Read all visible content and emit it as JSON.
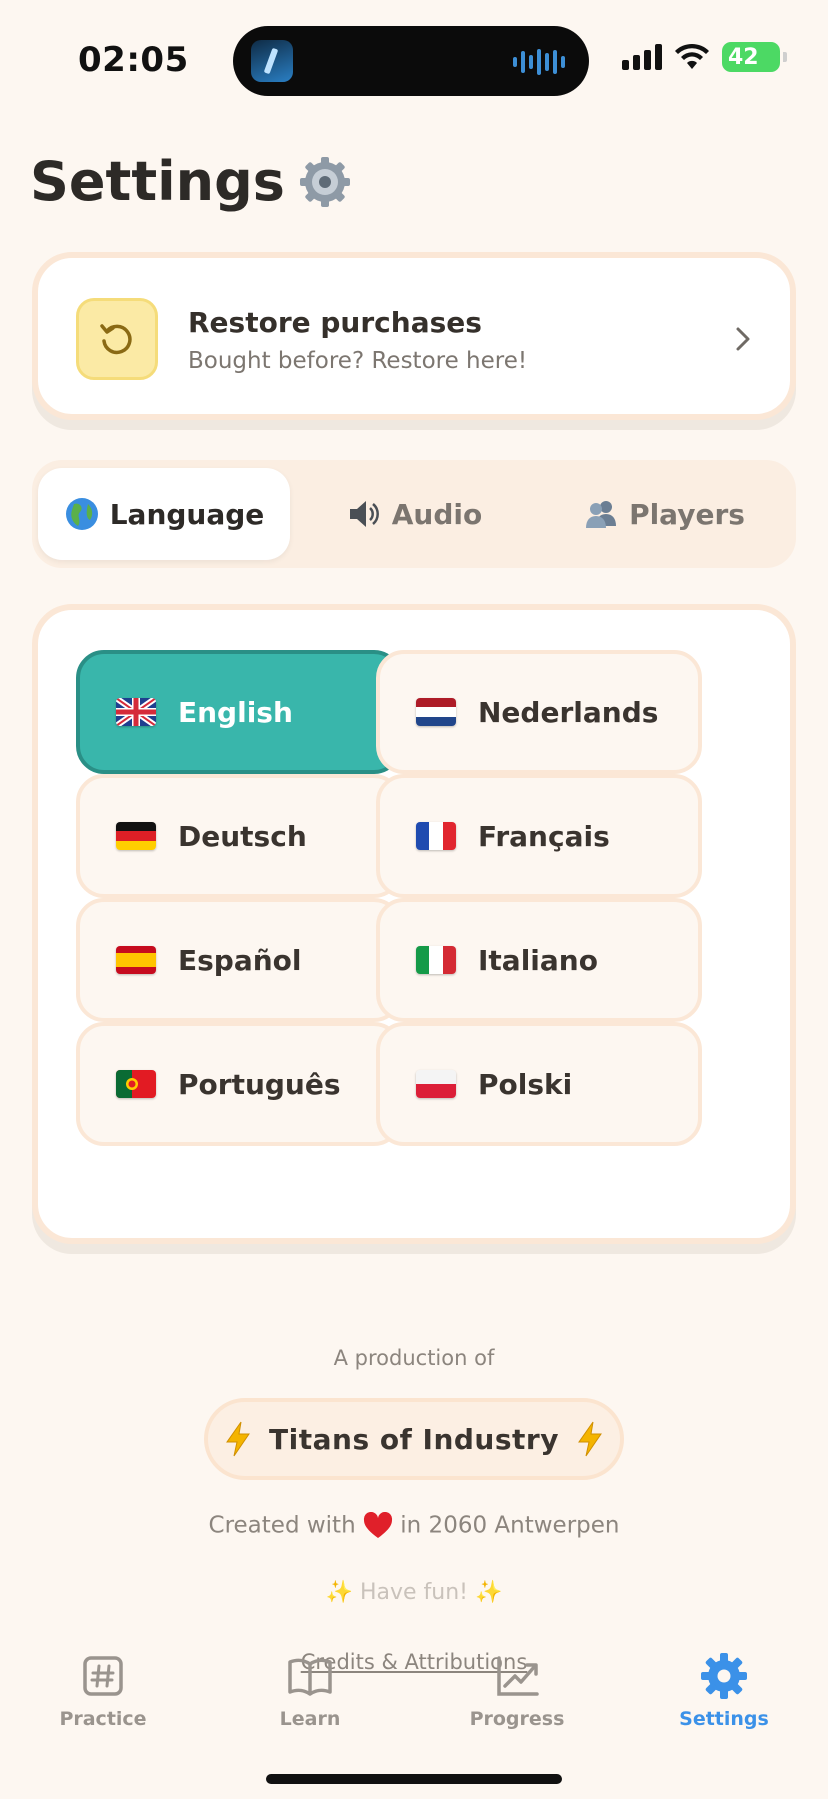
{
  "status_bar": {
    "time": "02:05",
    "battery_percent": "42"
  },
  "header": {
    "title": "Settings",
    "title_icon": "gear-icon"
  },
  "restore": {
    "title": "Restore purchases",
    "subtitle": "Bought before? Restore here!",
    "icon": "restore-icon"
  },
  "tabs": [
    {
      "label": "Language",
      "icon": "globe-icon",
      "active": true
    },
    {
      "label": "Audio",
      "icon": "speaker-icon",
      "active": false
    },
    {
      "label": "Players",
      "icon": "players-icon",
      "active": false
    }
  ],
  "languages": [
    {
      "label": "English",
      "flag": "uk-flag",
      "selected": true
    },
    {
      "label": "Nederlands",
      "flag": "nl-flag",
      "selected": false
    },
    {
      "label": "Deutsch",
      "flag": "de-flag",
      "selected": false
    },
    {
      "label": "Français",
      "flag": "fr-flag",
      "selected": false
    },
    {
      "label": "Español",
      "flag": "es-flag",
      "selected": false
    },
    {
      "label": "Italiano",
      "flag": "it-flag",
      "selected": false
    },
    {
      "label": "Português",
      "flag": "pt-flag",
      "selected": false
    },
    {
      "label": "Polski",
      "flag": "pl-flag",
      "selected": false
    }
  ],
  "footer": {
    "production_label": "A production of",
    "company": "Titans of Industry",
    "created_prefix": "Created with",
    "created_suffix": "in 2060 Antwerpen",
    "have_fun": "✨ Have fun! ✨",
    "credits_link": "Credits & Attributions"
  },
  "tabbar": [
    {
      "label": "Practice",
      "icon": "hash-icon",
      "active": false
    },
    {
      "label": "Learn",
      "icon": "book-icon",
      "active": false
    },
    {
      "label": "Progress",
      "icon": "chart-icon",
      "active": false
    },
    {
      "label": "Settings",
      "icon": "gear-icon",
      "active": true
    }
  ],
  "colors": {
    "background": "#fdf7f1",
    "accent_teal": "#39b6ab",
    "accent_blue": "#3b91e8",
    "restore_yellow": "#fbeaa5",
    "battery_green": "#4cd964"
  }
}
